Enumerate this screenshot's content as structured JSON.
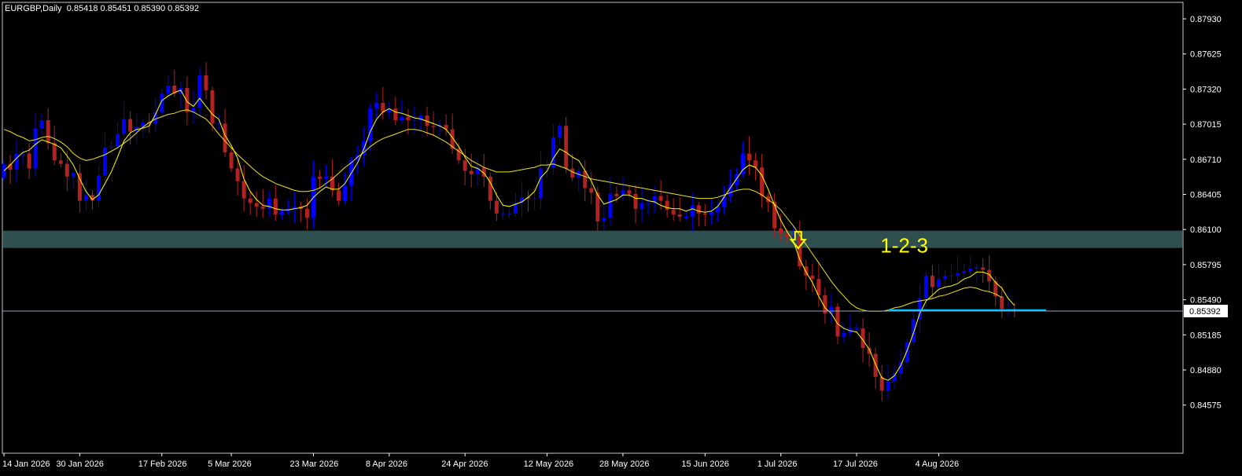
{
  "header": {
    "symbol": "EURGBP",
    "timeframe": "Daily",
    "open": "0.85418",
    "high": "0.85451",
    "low": "0.85390",
    "close": "0.85392"
  },
  "annotation_text": "1-2-3",
  "colors": {
    "background": "#000000",
    "bull_candle": "#0000ff",
    "bear_candle": "#b22222",
    "fast_ma": "#ffff00",
    "slow_ma": "#f0e020",
    "zone": "#2f4f4f",
    "support_line": "#00bfff",
    "axis": "#ffffff",
    "arrow": "#ffff00",
    "label_text": "#ffff00"
  },
  "chart_data": {
    "type": "candlestick",
    "symbol": "EURGBP",
    "timeframe": "Daily",
    "price_ticks": [
      "0.87930",
      "0.87625",
      "0.87320",
      "0.87015",
      "0.86710",
      "0.86405",
      "0.86100",
      "0.85795",
      "0.85490",
      "0.85185",
      "0.84880",
      "0.84575"
    ],
    "ylim": [
      0.8443,
      0.8801
    ],
    "date_labels": [
      "14 Jan 2026",
      "30 Jan 2026",
      "17 Feb 2026",
      "5 Mar 2026",
      "23 Mar 2026",
      "8 Apr 2026",
      "24 Apr 2026",
      "12 May 2026",
      "28 May 2026",
      "15 Jun 2026",
      "1 Jul 2026",
      "17 Jul 2026",
      "4 Aug 2026"
    ],
    "date_label_index": [
      0,
      12,
      25,
      36,
      49,
      61,
      73,
      86,
      98,
      111,
      123,
      135,
      148
    ],
    "current_price": "0.85392",
    "zone": {
      "low": 0.8594,
      "high": 0.8609
    },
    "support_level": 0.854,
    "support_span": [
      140,
      165
    ],
    "arrow_index": 125,
    "arrow_price": 0.8608,
    "label_index": 143,
    "label_price": 0.859,
    "closes": [
      0.8667,
      0.8662,
      0.8676,
      0.8676,
      0.8663,
      0.8698,
      0.8705,
      0.8685,
      0.867,
      0.8667,
      0.8656,
      0.8659,
      0.8635,
      0.864,
      0.8635,
      0.8657,
      0.8681,
      0.8682,
      0.8693,
      0.8706,
      0.8695,
      0.8699,
      0.8703,
      0.8702,
      0.8712,
      0.8728,
      0.8735,
      0.8728,
      0.8733,
      0.8712,
      0.8716,
      0.8744,
      0.8731,
      0.8702,
      0.8702,
      0.8677,
      0.8663,
      0.8652,
      0.8637,
      0.8633,
      0.863,
      0.8628,
      0.8637,
      0.8623,
      0.8626,
      0.8628,
      0.863,
      0.8628,
      0.862,
      0.8656,
      0.8654,
      0.8656,
      0.8644,
      0.8635,
      0.8648,
      0.867,
      0.8675,
      0.8687,
      0.8715,
      0.872,
      0.8712,
      0.8715,
      0.8705,
      0.8708,
      0.8705,
      0.8705,
      0.8709,
      0.87,
      0.8699,
      0.8701,
      0.8697,
      0.868,
      0.867,
      0.8661,
      0.8658,
      0.8664,
      0.8656,
      0.8635,
      0.8624,
      0.8624,
      0.8624,
      0.8633,
      0.8638,
      0.8637,
      0.8637,
      0.8663,
      0.8664,
      0.869,
      0.87,
      0.8663,
      0.8655,
      0.8661,
      0.8646,
      0.8642,
      0.8617,
      0.862,
      0.8641,
      0.8639,
      0.8644,
      0.8641,
      0.8628,
      0.8633,
      0.8633,
      0.8639,
      0.8635,
      0.8627,
      0.8623,
      0.8621,
      0.8621,
      0.8631,
      0.8624,
      0.8623,
      0.8625,
      0.863,
      0.8639,
      0.8649,
      0.8658,
      0.8676,
      0.867,
      0.8664,
      0.8639,
      0.8634,
      0.8611,
      0.8606,
      0.8604,
      0.8604,
      0.8578,
      0.857,
      0.8567,
      0.8553,
      0.8537,
      0.8543,
      0.8517,
      0.852,
      0.8524,
      0.8524,
      0.8507,
      0.8502,
      0.8482,
      0.847,
      0.8478,
      0.8485,
      0.8495,
      0.8512,
      0.8532,
      0.855,
      0.857,
      0.856,
      0.8567,
      0.857,
      0.857,
      0.8572,
      0.8574,
      0.8576,
      0.8577,
      0.8575,
      0.8565,
      0.8552,
      0.8541,
      0.8541,
      0.8539
    ],
    "fast_ma": [
      0.8661,
      0.8666,
      0.8672,
      0.8677,
      0.8679,
      0.8684,
      0.8688,
      0.8686,
      0.8684,
      0.8681,
      0.8674,
      0.8666,
      0.8654,
      0.8643,
      0.8636,
      0.864,
      0.865,
      0.866,
      0.8673,
      0.8687,
      0.8694,
      0.8697,
      0.8698,
      0.87,
      0.871,
      0.8722,
      0.8726,
      0.8729,
      0.8731,
      0.8721,
      0.8717,
      0.8724,
      0.8717,
      0.871,
      0.8706,
      0.8692,
      0.8683,
      0.8672,
      0.8654,
      0.8643,
      0.8636,
      0.8631,
      0.863,
      0.8628,
      0.8627,
      0.8627,
      0.8628,
      0.8629,
      0.8631,
      0.8638,
      0.8643,
      0.8647,
      0.8645,
      0.8645,
      0.865,
      0.8659,
      0.8668,
      0.868,
      0.8695,
      0.8706,
      0.8712,
      0.8715,
      0.8712,
      0.8711,
      0.8709,
      0.8707,
      0.8706,
      0.8704,
      0.8702,
      0.87,
      0.8697,
      0.869,
      0.8682,
      0.8673,
      0.8665,
      0.8663,
      0.8659,
      0.8651,
      0.864,
      0.8631,
      0.863,
      0.8632,
      0.8634,
      0.8638,
      0.8643,
      0.8655,
      0.8661,
      0.8672,
      0.868,
      0.8677,
      0.8673,
      0.867,
      0.8661,
      0.8652,
      0.864,
      0.8632,
      0.8634,
      0.8636,
      0.864,
      0.864,
      0.8637,
      0.8637,
      0.8635,
      0.8634,
      0.8631,
      0.8629,
      0.8628,
      0.8628,
      0.8626,
      0.8628,
      0.8626,
      0.8625,
      0.8626,
      0.863,
      0.8638,
      0.8646,
      0.8654,
      0.8662,
      0.8666,
      0.8664,
      0.8657,
      0.8645,
      0.8631,
      0.8618,
      0.8608,
      0.86,
      0.8584,
      0.8573,
      0.8564,
      0.8552,
      0.8542,
      0.8537,
      0.8528,
      0.8524,
      0.8522,
      0.8521,
      0.8514,
      0.8506,
      0.8493,
      0.8481,
      0.8479,
      0.8483,
      0.8492,
      0.8505,
      0.852,
      0.8537,
      0.8548,
      0.8553,
      0.8558,
      0.856,
      0.8561,
      0.8563,
      0.8567,
      0.8569,
      0.8573,
      0.8573,
      0.8571,
      0.8564,
      0.8559,
      0.855,
      0.8544
    ],
    "slow_ma": [
      0.8697,
      0.8695,
      0.8692,
      0.869,
      0.8687,
      0.8688,
      0.869,
      0.8691,
      0.8689,
      0.8686,
      0.8682,
      0.8676,
      0.8672,
      0.867,
      0.8671,
      0.8673,
      0.8675,
      0.8678,
      0.8681,
      0.8685,
      0.8689,
      0.8694,
      0.8699,
      0.8703,
      0.8706,
      0.8708,
      0.871,
      0.8711,
      0.8713,
      0.8714,
      0.8712,
      0.8709,
      0.8706,
      0.87,
      0.8693,
      0.8687,
      0.8681,
      0.8675,
      0.867,
      0.8665,
      0.866,
      0.8656,
      0.8653,
      0.865,
      0.8648,
      0.8646,
      0.8644,
      0.8643,
      0.8643,
      0.8644,
      0.8646,
      0.865,
      0.8654,
      0.8659,
      0.8664,
      0.8668,
      0.8673,
      0.8677,
      0.8682,
      0.8686,
      0.8689,
      0.8691,
      0.8693,
      0.8695,
      0.8697,
      0.8697,
      0.8696,
      0.8694,
      0.8692,
      0.8689,
      0.8686,
      0.8682,
      0.8678,
      0.8674,
      0.867,
      0.8667,
      0.8664,
      0.8662,
      0.866,
      0.866,
      0.866,
      0.8661,
      0.8662,
      0.8663,
      0.8664,
      0.8666,
      0.8666,
      0.8667,
      0.8665,
      0.8663,
      0.866,
      0.8658,
      0.8656,
      0.8654,
      0.8653,
      0.8652,
      0.8651,
      0.865,
      0.8649,
      0.8648,
      0.8647,
      0.8646,
      0.8645,
      0.8644,
      0.8643,
      0.8642,
      0.8641,
      0.864,
      0.8639,
      0.8638,
      0.8637,
      0.8637,
      0.8637,
      0.8638,
      0.864,
      0.8642,
      0.8644,
      0.8645,
      0.8645,
      0.8643,
      0.864,
      0.8636,
      0.8632,
      0.8627,
      0.862,
      0.8613,
      0.8605,
      0.8597,
      0.8589,
      0.8581,
      0.8573,
      0.8565,
      0.8558,
      0.8552,
      0.8546,
      0.8542,
      0.854,
      0.8539,
      0.8539,
      0.8539,
      0.854,
      0.8542,
      0.8543,
      0.8545,
      0.8547,
      0.8548,
      0.8549,
      0.855,
      0.8552,
      0.8553,
      0.8555,
      0.8557,
      0.8559,
      0.856,
      0.8559,
      0.8557,
      0.8556,
      0.8554,
      0.8551
    ]
  }
}
